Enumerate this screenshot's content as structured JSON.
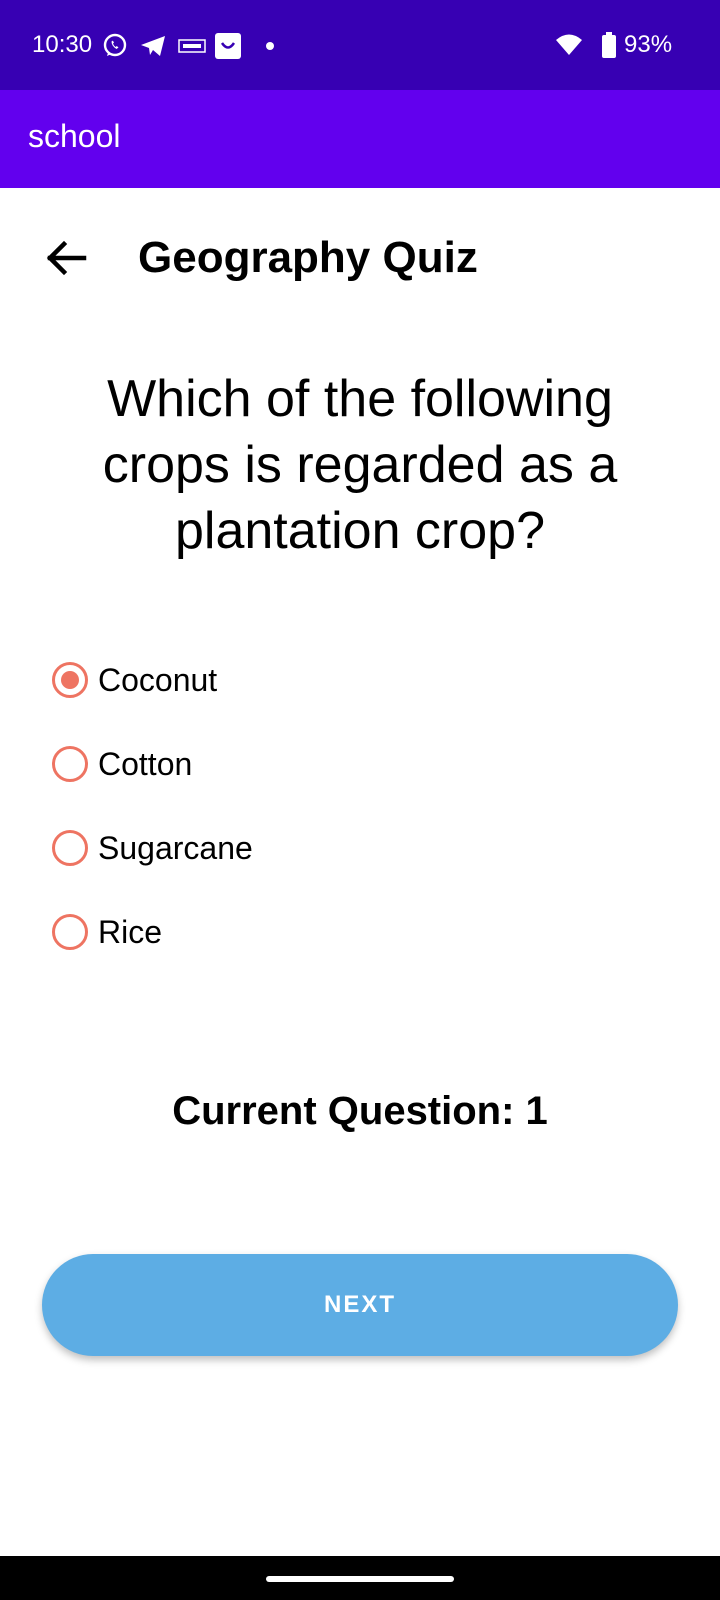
{
  "status_bar": {
    "time": "10:30",
    "battery": "93%",
    "icons": [
      "whatsapp-icon",
      "telegram-icon",
      "goalt-icon",
      "shopping-bag-icon",
      "notification-dot-icon",
      "wifi-icon",
      "battery-icon"
    ]
  },
  "app_bar": {
    "title": "school",
    "color": "#6200ee"
  },
  "header": {
    "title": "Geography Quiz",
    "back_icon": "arrow-left-icon"
  },
  "question": {
    "text": "Which of the following crops is regarded as a plantation crop?"
  },
  "options": [
    {
      "label": "Coconut",
      "selected": true
    },
    {
      "label": "Cotton",
      "selected": false
    },
    {
      "label": "Sugarcane",
      "selected": false
    },
    {
      "label": "Rice",
      "selected": false
    }
  ],
  "progress": {
    "current_label": "Current Question: 1"
  },
  "next_button": {
    "label": "NEXT",
    "color": "#5dade4"
  },
  "colors": {
    "status_bar": "#3700b3",
    "radio_accent": "#ee7462"
  }
}
